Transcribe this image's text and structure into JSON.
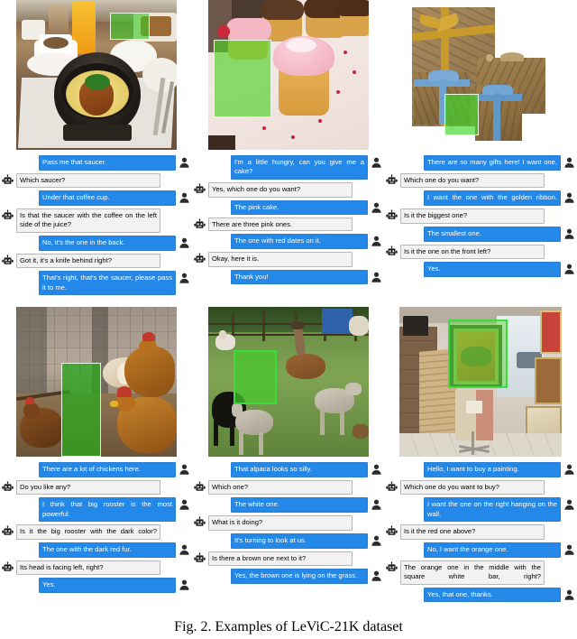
{
  "caption": "Fig. 2. Examples of LeViC-21K dataset",
  "icons": {
    "bot": "robot-icon",
    "user": "person-icon"
  },
  "colors": {
    "user_bubble": "#2488e8",
    "bot_bubble": "#f2f2f2",
    "mask_green": "#3cc828",
    "user_text": "#ffffff",
    "bot_text": "#000000"
  },
  "panels": [
    {
      "id": "panel-saucer",
      "image": {
        "alt": "Breakfast table with a stone bowl of food, coffee cup, orange juice glass",
        "mask_label": "green-highlight-region"
      },
      "messages": [
        {
          "speaker": "user",
          "text": "Pass me that saucer."
        },
        {
          "speaker": "bot",
          "text": "Which saucer?"
        },
        {
          "speaker": "user",
          "text": "Under that coffee cup."
        },
        {
          "speaker": "bot",
          "text": "Is that the saucer with the coffee on the left side of the juice?"
        },
        {
          "speaker": "user",
          "text": "No, it's the one in the back."
        },
        {
          "speaker": "bot",
          "text": "Got it, it's a knife behind right?"
        },
        {
          "speaker": "user",
          "text": "That's right, that's the saucer, please pass it to me."
        }
      ]
    },
    {
      "id": "panel-cake",
      "image": {
        "alt": "Plate of cupcakes with pink and chocolate frosting",
        "mask_label": "green-highlight-region"
      },
      "messages": [
        {
          "speaker": "user",
          "text": "I'm a little hungry, can you give me a cake?"
        },
        {
          "speaker": "bot",
          "text": "Yes, which one do you want?"
        },
        {
          "speaker": "user",
          "text": "The pink cake."
        },
        {
          "speaker": "bot",
          "text": "There are three pink ones."
        },
        {
          "speaker": "user",
          "text": "The one with red dates on it."
        },
        {
          "speaker": "bot",
          "text": "Okay, here it is."
        },
        {
          "speaker": "user",
          "text": "Thank you!"
        }
      ]
    },
    {
      "id": "panel-gifts",
      "image": {
        "alt": "Several gift boxes wrapped in brown paper with blue and gold ribbons",
        "mask_label": "green-highlight-region"
      },
      "messages": [
        {
          "speaker": "user",
          "text": "There are so many gifts here! I want one."
        },
        {
          "speaker": "bot",
          "text": "Which one do you want?"
        },
        {
          "speaker": "user",
          "text": "I want the one with the golden ribbon."
        },
        {
          "speaker": "bot",
          "text": "Is it the biggest one?"
        },
        {
          "speaker": "user",
          "text": "The smallest one."
        },
        {
          "speaker": "bot",
          "text": "Is it the one on the front left?"
        },
        {
          "speaker": "user",
          "text": "Yes."
        }
      ]
    },
    {
      "id": "panel-chickens",
      "image": {
        "alt": "A group of chickens and roosters in a dirt yard by a stone wall",
        "mask_label": "green-highlight-region"
      },
      "messages": [
        {
          "speaker": "user",
          "text": "There are a lot of chickens here."
        },
        {
          "speaker": "bot",
          "text": "Do you like any?"
        },
        {
          "speaker": "user",
          "text": "I think that big rooster is the most powerful."
        },
        {
          "speaker": "bot",
          "text": "Is it the big rooster with the dark color?"
        },
        {
          "speaker": "user",
          "text": "The one with the dark red fur."
        },
        {
          "speaker": "bot",
          "text": "Its head is facing left, right?"
        },
        {
          "speaker": "user",
          "text": "Yes."
        }
      ]
    },
    {
      "id": "panel-alpaca",
      "image": {
        "alt": "Alpacas grazing in a green grassy field with a fence",
        "mask_label": "green-highlight-region"
      },
      "messages": [
        {
          "speaker": "user",
          "text": "That alpaca looks so silly."
        },
        {
          "speaker": "bot",
          "text": "Which one?"
        },
        {
          "speaker": "user",
          "text": "The white one."
        },
        {
          "speaker": "bot",
          "text": "What is it doing?"
        },
        {
          "speaker": "user",
          "text": "It's turning to look at us."
        },
        {
          "speaker": "bot",
          "text": "Is there a brown one next to it?"
        },
        {
          "speaker": "user",
          "text": "Yes, the brown one is lying on the grass."
        }
      ]
    },
    {
      "id": "panel-painting",
      "image": {
        "alt": "Interior of an art shop with framed paintings on display",
        "mask_label": "green-highlight-region"
      },
      "messages": [
        {
          "speaker": "user",
          "text": "Hello, I want to buy a painting."
        },
        {
          "speaker": "bot",
          "text": "Which one do you want to buy?"
        },
        {
          "speaker": "user",
          "text": "I want the one on the right hanging on the wall."
        },
        {
          "speaker": "bot",
          "text": "Is it the red one above?"
        },
        {
          "speaker": "user",
          "text": "No, I want the orange one."
        },
        {
          "speaker": "bot",
          "text": "The orange one in the middle with the square white bar, right?"
        },
        {
          "speaker": "user",
          "text": "Yes, that one, thanks."
        }
      ]
    }
  ]
}
